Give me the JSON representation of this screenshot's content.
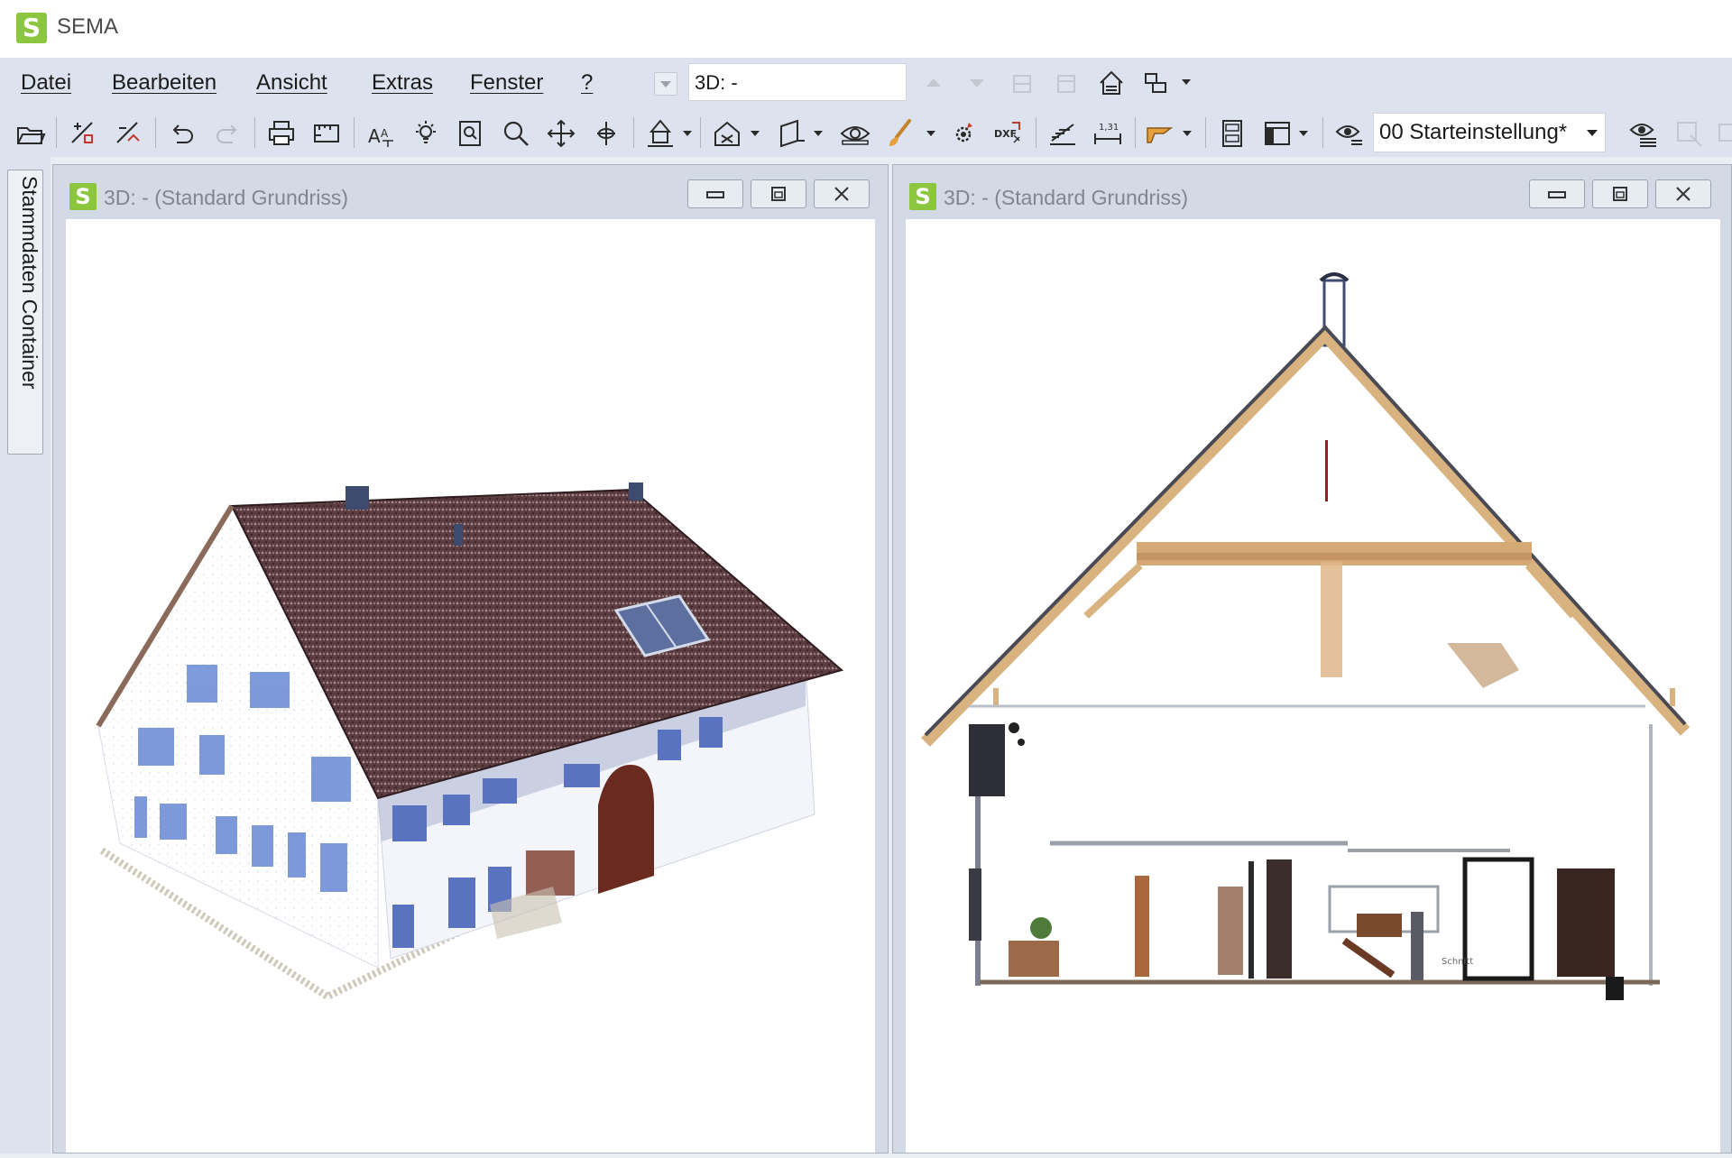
{
  "app": {
    "title": "SEMA",
    "logo_letter": "S"
  },
  "menu": {
    "items": [
      "Datei",
      "Bearbeiten",
      "Ansicht",
      "Extras",
      "Fenster",
      "?"
    ]
  },
  "view_field": {
    "value": "3D: -"
  },
  "toolbar": {
    "preset_value": "00 Starteinstellung*",
    "icons": [
      "open-folder-icon",
      "wall-tool-icon",
      "roof-tool-icon",
      "undo-icon",
      "redo-icon",
      "print-icon",
      "layout-icon",
      "text-style-icon",
      "light-icon",
      "zoom-window-icon",
      "zoom-icon",
      "pan-icon",
      "rotate-icon",
      "perspective-icon",
      "view-house-icon",
      "section-icon",
      "visibility-eye-icon",
      "paint-brush-icon",
      "render-settings-icon",
      "dxf-export-icon",
      "stairs-icon",
      "dimension-icon",
      "material-icon",
      "list-icon",
      "panel-layout-icon",
      "visibility-preset-icon",
      "visibility-manage-icon"
    ]
  },
  "sidebar": {
    "tab_label": "Stammdaten Container"
  },
  "windows": [
    {
      "logo_letter": "S",
      "title": "3D: - (Standard Grundriss)",
      "content": "point-cloud-house-exterior"
    },
    {
      "logo_letter": "S",
      "title": "3D: - (Standard Grundriss)",
      "content": "point-cloud-house-section"
    }
  ],
  "section_label": "Schnitt",
  "colors": {
    "brand_green": "#8cc63f",
    "chrome": "#dde3ee",
    "roof": "#5a3b3e",
    "walls": "#ffffff",
    "window_blue": "#6f8fd6",
    "timber": "#d8b380"
  }
}
